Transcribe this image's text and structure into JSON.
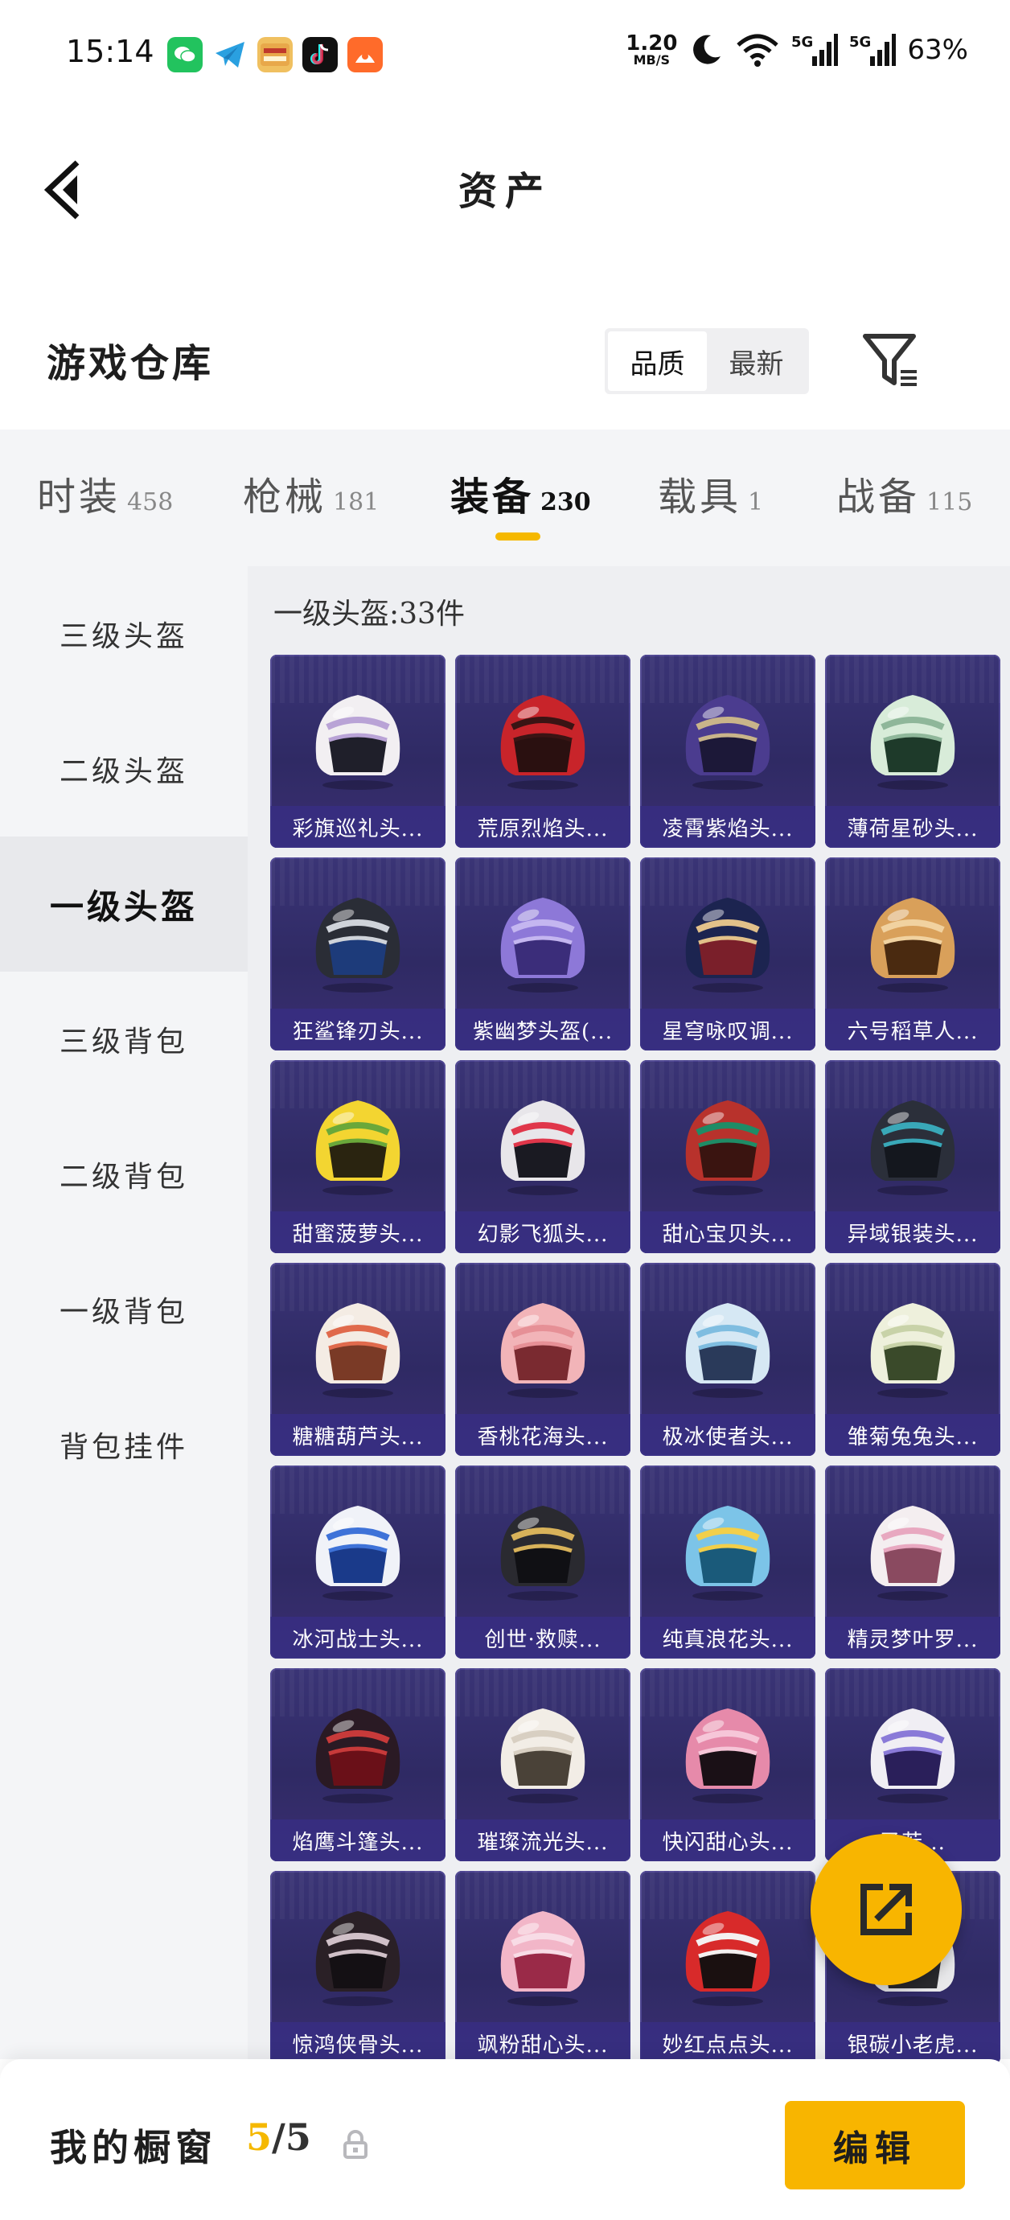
{
  "status_bar": {
    "time": "15:14",
    "apps": [
      "wechat-icon",
      "telegram-icon",
      "game-icon",
      "tiktok-icon",
      "app-icon"
    ],
    "net_speed_value": "1.20",
    "net_speed_unit": "MB/S",
    "battery": "63%"
  },
  "header": {
    "title": "资产",
    "back_icon": "chevron-left-icon"
  },
  "warehouse": {
    "title": "游戏仓库",
    "sort_options": [
      "品质",
      "最新"
    ],
    "active_sort": "品质",
    "filter_icon": "filter-icon"
  },
  "tabs": [
    {
      "label": "时装",
      "count": "458"
    },
    {
      "label": "枪械",
      "count": "181"
    },
    {
      "label": "装备",
      "count": "230"
    },
    {
      "label": "载具",
      "count": "1"
    },
    {
      "label": "战备",
      "count": "115"
    }
  ],
  "active_tab": "装备",
  "accent_color": "#f5b800",
  "sidebar": {
    "items": [
      "三级头盔",
      "二级头盔",
      "一级头盔",
      "三级背包",
      "二级背包",
      "一级背包",
      "背包挂件"
    ],
    "active": "一级头盔"
  },
  "grid": {
    "title": "一级头盔:33件",
    "items": [
      {
        "name": "彩旗巡礼头...",
        "shell": "#f2eff2",
        "trim": "#b9a3d6",
        "visor": "#1f1f2a"
      },
      {
        "name": "荒原烈焰头...",
        "shell": "#c8242a",
        "trim": "#3a1414",
        "visor": "#2a1010"
      },
      {
        "name": "凌霄紫焰头...",
        "shell": "#4b3c8f",
        "trim": "#c9b48a",
        "visor": "#1c1838"
      },
      {
        "name": "薄荷星砂头...",
        "shell": "#d8ecd9",
        "trim": "#8fb79a",
        "visor": "#1e3a2a"
      },
      {
        "name": "狂鲨锋刃头...",
        "shell": "#2a2d36",
        "trim": "#cfd3da",
        "visor": "#1d3b7a"
      },
      {
        "name": "紫幽梦头盔(...",
        "shell": "#8d78d8",
        "trim": "#c4b6f0",
        "visor": "#3b2d7a"
      },
      {
        "name": "星穹咏叹调...",
        "shell": "#1c2450",
        "trim": "#e2c18a",
        "visor": "#7a1f2a"
      },
      {
        "name": "六号稻草人...",
        "shell": "#d9a05a",
        "trim": "#f1d2a0",
        "visor": "#4a2a10"
      },
      {
        "name": "甜蜜菠萝头...",
        "shell": "#f3d531",
        "trim": "#6aa83a",
        "visor": "#2a2410"
      },
      {
        "name": "幻影飞狐头...",
        "shell": "#e8e6ea",
        "trim": "#e0364a",
        "visor": "#1a1a22"
      },
      {
        "name": "甜心宝贝头...",
        "shell": "#b8322c",
        "trim": "#1f8c66",
        "visor": "#3a1410"
      },
      {
        "name": "异域银装头...",
        "shell": "#2b2f3a",
        "trim": "#39a8b8",
        "visor": "#14171e"
      },
      {
        "name": "糖糖葫芦头...",
        "shell": "#f4ece4",
        "trim": "#e06a4c",
        "visor": "#7a3a26"
      },
      {
        "name": "香桃花海头...",
        "shell": "#f2b4b8",
        "trim": "#e69096",
        "visor": "#7a2a30"
      },
      {
        "name": "极冰使者头...",
        "shell": "#d6e8f4",
        "trim": "#7fbde0",
        "visor": "#2a3a5a"
      },
      {
        "name": "雏菊兔兔头...",
        "shell": "#eef0dc",
        "trim": "#c8d2a8",
        "visor": "#3a4a2a"
      },
      {
        "name": "冰河战士头...",
        "shell": "#f0f2f8",
        "trim": "#3e72d8",
        "visor": "#1a3a8a"
      },
      {
        "name": "创世·救赎...",
        "shell": "#2a2a30",
        "trim": "#d8b25a",
        "visor": "#101014"
      },
      {
        "name": "纯真浪花头...",
        "shell": "#7cc4e8",
        "trim": "#f2cf4a",
        "visor": "#1a5a7a"
      },
      {
        "name": "精灵梦叶罗...",
        "shell": "#f4eef0",
        "trim": "#e8a8c0",
        "visor": "#8a4a60"
      },
      {
        "name": "焰鹰斗篷头...",
        "shell": "#2a1a24",
        "trim": "#c73a3a",
        "visor": "#6a1018"
      },
      {
        "name": "璀璨流光头...",
        "shell": "#f2ede6",
        "trim": "#d8cfc2",
        "visor": "#4a4238"
      },
      {
        "name": "快闪甜心头...",
        "shell": "#e68aaa",
        "trim": "#f6c6d8",
        "visor": "#1a1016"
      },
      {
        "name": "圣若...",
        "shell": "#f0eef4",
        "trim": "#8a7ad8",
        "visor": "#2a1f5a"
      },
      {
        "name": "惊鸿侠骨头...",
        "shell": "#2a2026",
        "trim": "#d0c0c8",
        "visor": "#141014"
      },
      {
        "name": "飒粉甜心头...",
        "shell": "#f2b6c8",
        "trim": "#f8dce6",
        "visor": "#9a2a48"
      },
      {
        "name": "妙红点点头...",
        "shell": "#d82a2a",
        "trim": "#f4f0f0",
        "visor": "#1a1010"
      },
      {
        "name": "银碳小老虎...",
        "shell": "#e8e8ea",
        "trim": "#2a2a2e",
        "visor": "#2a2a2e"
      }
    ]
  },
  "bottom_bar": {
    "title": "我的橱窗",
    "count_current": "5",
    "count_separator": "/",
    "count_max": "5",
    "lock_icon": "lock-icon",
    "edit_label": "编辑"
  },
  "fab_icon": "share-icon"
}
